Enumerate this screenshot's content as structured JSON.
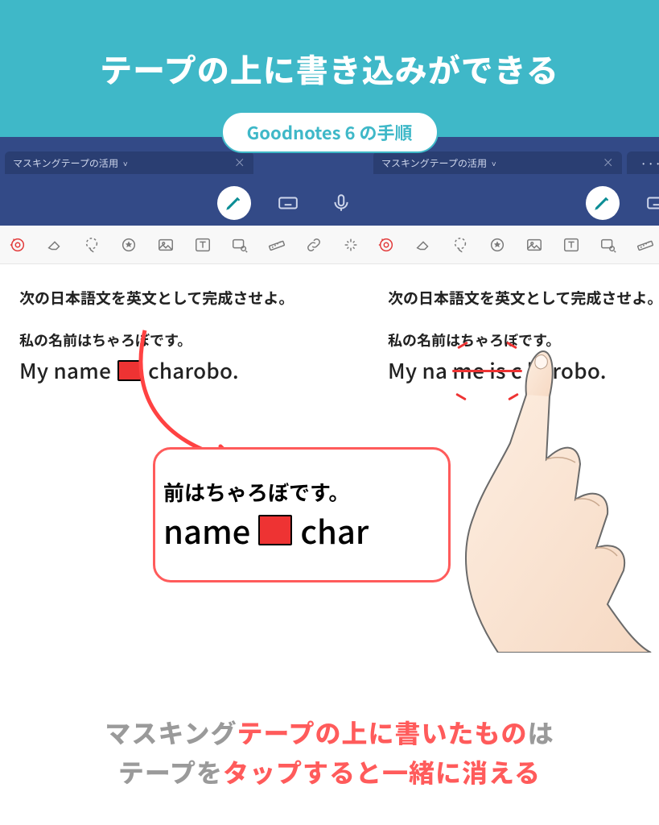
{
  "banner": {
    "title": "テープの上に書き込みができる"
  },
  "pill": {
    "label": "Goodnotes 6 の手順"
  },
  "app": {
    "tab_title": "マスキングテープの活用",
    "tab_chevron": "˅",
    "tab_close": "×",
    "more": "···"
  },
  "tools": {
    "names": [
      "tape-tool",
      "eraser-tool",
      "lasso-tool",
      "stamp-tool",
      "image-tool",
      "text-tool",
      "search-image-tool",
      "ruler-tool",
      "link-tool",
      "sparkle-tool"
    ]
  },
  "left_doc": {
    "jp1": "次の日本語文を英文として完成させよ。",
    "jp2": "私の名前はちゃろぼです。",
    "en_before": "My name",
    "en_after": "charobo."
  },
  "right_doc": {
    "jp1": "次の日本語文を英文として完成させよ。",
    "jp2": "私の名前はちゃろぼです。",
    "en_a": "My na",
    "en_b": "me is c",
    "en_c": "harobo."
  },
  "zoom": {
    "line1": "前はちゃろぼです。",
    "line2a": "name",
    "line2b": "char"
  },
  "caption": {
    "p1a": "マスキング",
    "p1b": "テープの上に書いたもの",
    "p1c": "は",
    "p2a": "テープを",
    "p2b": "タップすると一緒に消える"
  }
}
